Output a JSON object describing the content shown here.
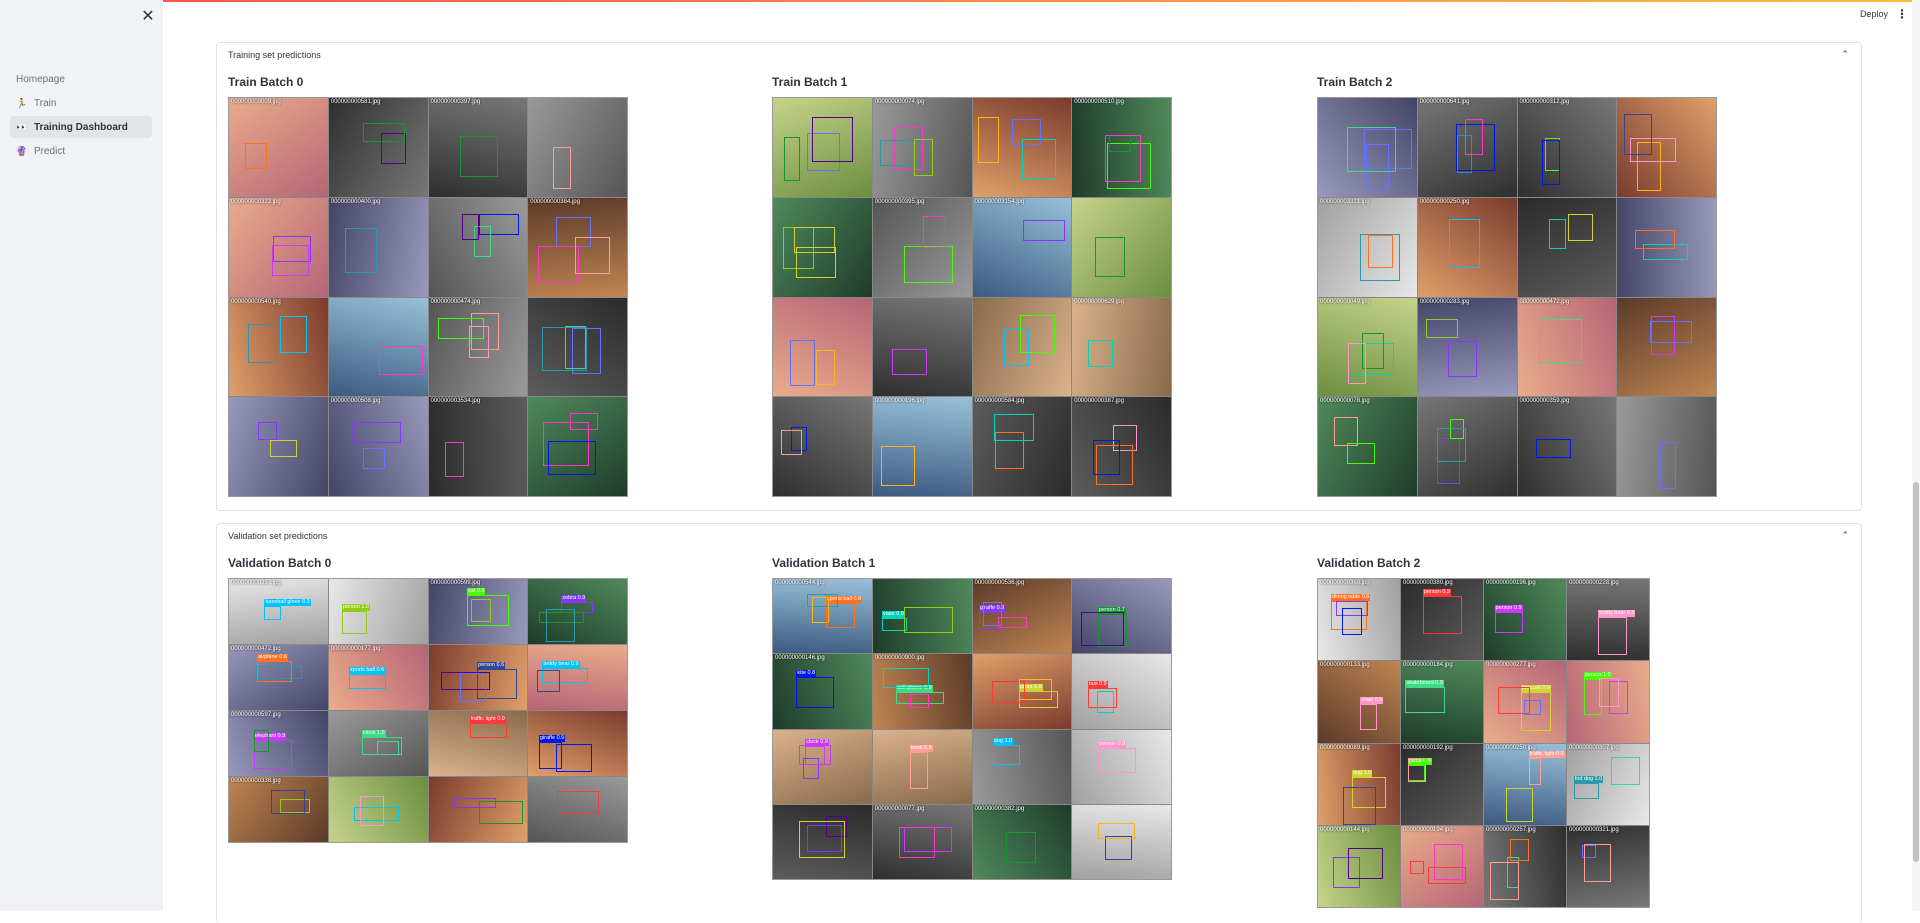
{
  "sidebar": {
    "close_label": "✕",
    "nav": [
      {
        "label": "Homepage",
        "icon": "",
        "active": false
      },
      {
        "label": "Train",
        "icon": "🏃",
        "active": false
      },
      {
        "label": "Training Dashboard",
        "icon": "👀",
        "active": true
      },
      {
        "label": "Predict",
        "icon": "🔮",
        "active": false
      }
    ]
  },
  "header": {
    "deploy_label": "Deploy",
    "menu_icon": "⋮"
  },
  "sections": [
    {
      "title": "Training set predictions",
      "collapse_icon": "⌃",
      "batches": [
        {
          "title": "Train Batch 0"
        },
        {
          "title": "Train Batch 1"
        },
        {
          "title": "Train Batch 2"
        }
      ]
    },
    {
      "title": "Validation set predictions",
      "collapse_icon": "⌃",
      "batches": [
        {
          "title": "Validation Batch 0"
        },
        {
          "title": "Validation Batch 1"
        },
        {
          "title": "Validation Batch 2"
        }
      ]
    }
  ],
  "tiles": {
    "train0": [
      "000000000009.jpg",
      "000000000581.jpg",
      "000000000397.jpg",
      "",
      "000000000322.jpg",
      "000000000400.jpg",
      "",
      "000000000384.jpg",
      "000000000540.jpg",
      "",
      "000000000474.jpg",
      "",
      "",
      "000000000508.jpg",
      "000000003534.jpg",
      ""
    ],
    "train1": [
      "",
      "000000000074.jpg",
      "",
      "000000000510.jpg",
      "",
      "000000000395.jpg",
      "000000003154.jpg",
      "",
      "",
      "",
      "",
      "000000000629.jpg",
      "",
      "000000000196.jpg",
      "000000000584.jpg",
      "000000000387.jpg"
    ],
    "train2": [
      "",
      "000000000641.jpg",
      "000000000312.jpg",
      "",
      "000000003321.jpg",
      "000000000250.jpg",
      "",
      "",
      "000000000049.jpg",
      "000000000283.jpg",
      "000000000472.jpg",
      "",
      "000000000078.jpg",
      "",
      "000000000359.jpg",
      ""
    ],
    "val0": [
      "000000000357.jpg",
      "",
      "000000000599.jpg",
      "",
      "000000000472.jpg",
      "000000000177.jpg",
      "",
      "",
      "000000000597.jpg",
      "",
      "",
      "",
      "000000000338.jpg",
      "",
      "",
      ""
    ],
    "val1": [
      "000000000544.jpg",
      "",
      "000000000536.jpg",
      "",
      "000000000146.jpg",
      "000000000900.jpg",
      "",
      "",
      "",
      "",
      "",
      "",
      "",
      "000000000077.jpg",
      "000000000382.jpg",
      ""
    ],
    "val2": [
      "000000000360.jpg",
      "000000000380.jpg",
      "000000000196.jpg",
      "000000000228.jpg",
      "000000000133.jpg",
      "000000000184.jpg",
      "000000000277.jpg",
      "",
      "000000000089.jpg",
      "000000000192.jpg",
      "000000000250.jpg",
      "000000000307.jpg",
      "000000000144.jpg",
      "000000000194.jpg",
      "000000000257.jpg",
      "000000000321.jpg"
    ]
  },
  "labels": {
    "val0": [
      "baseball glove 0.3",
      "person 1.0",
      "cat 0.9",
      "zebra 0.9",
      "airplane 0.6",
      "sports ball 0.6",
      "person 0.6",
      "teddy bear 0.9",
      "elephant 0.9",
      "clock 1.0",
      "traffic light 0.9",
      "giraffe 0.9"
    ],
    "val1": [
      "sports ball 0.8",
      "vase 0.9",
      "giraffe 0.9",
      "person 0.7",
      "kite 0.8",
      "cell phone 0.9",
      "pizza 0.9",
      "bus 0.9",
      "clock 0.9",
      "book 0.8",
      "dog 1.0",
      "person 0.9"
    ],
    "val2": [
      "dining table 0.6",
      "person 0.9",
      "person 0.9",
      "teddy bear 0.9",
      "chair 0.9",
      "skateboard 0.9",
      "broccoli 0.9",
      "person 1.0",
      "dog 1.0",
      "pizza 0.9",
      "traffic light 0.9",
      "hot dog 1.0"
    ]
  }
}
